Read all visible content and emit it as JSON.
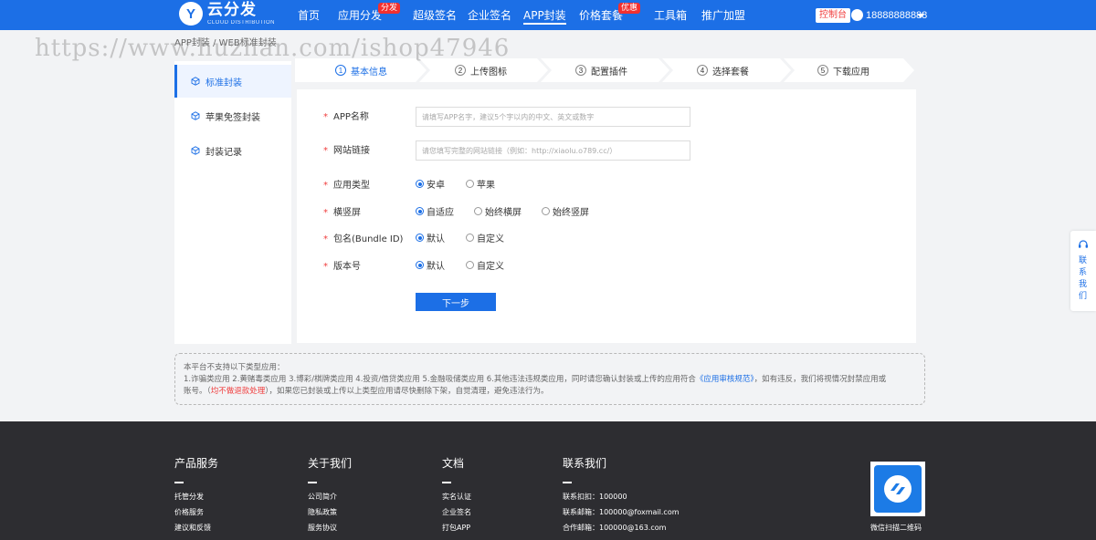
{
  "header": {
    "logo_letter": "Y",
    "logo_title": "云分发",
    "logo_subtitle": "CLOUD DISTRIBUTION",
    "nav": [
      {
        "label": "首页",
        "badge": ""
      },
      {
        "label": "应用分发",
        "badge": "分发"
      },
      {
        "label": "超级签名",
        "badge": ""
      },
      {
        "label": "企业签名",
        "badge": ""
      },
      {
        "label": "APP封装",
        "badge": ""
      },
      {
        "label": "价格套餐",
        "badge": "优惠"
      },
      {
        "label": "工具箱",
        "badge": ""
      },
      {
        "label": "推广加盟",
        "badge": ""
      }
    ],
    "console_label": "控制台",
    "username": "18888888888"
  },
  "watermark": "https://www.huzhan.com/ishop47946",
  "breadcrumb": "APP封装 / WEB标准封装",
  "sidebar": {
    "items": [
      {
        "label": "标准封装"
      },
      {
        "label": "苹果免签封装"
      },
      {
        "label": "封装记录"
      }
    ]
  },
  "steps": [
    {
      "num": "1",
      "label": "基本信息"
    },
    {
      "num": "2",
      "label": "上传图标"
    },
    {
      "num": "3",
      "label": "配置插件"
    },
    {
      "num": "4",
      "label": "选择套餐"
    },
    {
      "num": "5",
      "label": "下载应用"
    }
  ],
  "form": {
    "required_mark": "*",
    "app_name_label": "APP名称",
    "app_name_placeholder": "请填写APP名字，建议5个字以内的中文、英文或数字",
    "url_label": "网站链接",
    "url_placeholder": "请您填写完整的网站链接（例如：http://xiaolu.o789.cc/）",
    "app_type_label": "应用类型",
    "app_type_options": [
      "安卓",
      "苹果"
    ],
    "orientation_label": "横竖屏",
    "orientation_options": [
      "自适应",
      "始终横屏",
      "始终竖屏"
    ],
    "bundle_label": "包名(Bundle ID)",
    "bundle_options": [
      "默认",
      "自定义"
    ],
    "version_label": "版本号",
    "version_options": [
      "默认",
      "自定义"
    ],
    "next_button": "下一步"
  },
  "notice": {
    "line1": "本平台不支持以下类型应用：",
    "line2_prefix": "1.诈骗类应用 2.黄赌毒类应用 3.博彩/棋牌类应用 4.投资/借贷类应用 5.金融吸储类应用 6.其他违法违规类应用，同时请您确认封装或上传的应用符合",
    "line2_link": "《应用审核规范》",
    "line2_suffix": "，如有违反，我们将视情况封禁应用或",
    "line3_prefix": "账号。（",
    "line3_warn": "均不做退款处理",
    "line3_suffix": "），如果您已封装或上传以上类型应用请尽快删除下架，自觉清理，避免违法行为。"
  },
  "contact_float": "联系我们",
  "footer": {
    "columns": [
      {
        "title": "产品服务",
        "links": [
          "托管分发",
          "价格服务",
          "建议和反馈"
        ]
      },
      {
        "title": "关于我们",
        "links": [
          "公司简介",
          "隐私政策",
          "服务协议"
        ]
      },
      {
        "title": "文档",
        "links": [
          "实名认证",
          "企业签名",
          "打包APP"
        ]
      },
      {
        "title": "联系我们",
        "links": [
          "联系扣扣：100000",
          "联系邮箱：100000@foxmail.com",
          "合作邮箱：100000@163.com"
        ]
      }
    ],
    "qr_caption": "微信扫描二维码"
  },
  "colors": {
    "brand": "#1c6fe6",
    "footer_bg": "#2d2d31",
    "warn": "#f03e3e"
  }
}
